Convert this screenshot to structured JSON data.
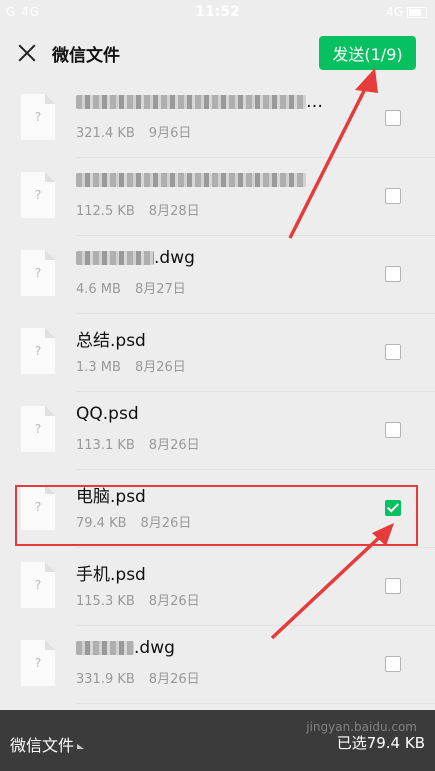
{
  "status": {
    "left": "G 4G",
    "time": "11:52",
    "right": "4G"
  },
  "header": {
    "title": "微信文件",
    "send_label": "发送(1/9)"
  },
  "files": [
    {
      "name": "…",
      "size": "321.4 KB",
      "date": "9月6日",
      "checked": false,
      "blur_w": 230
    },
    {
      "name": "",
      "size": "112.5 KB",
      "date": "8月28日",
      "checked": false,
      "blur_w": 230
    },
    {
      "name": ".dwg",
      "size": "4.6 MB",
      "date": "8月27日",
      "checked": false,
      "blur_w": 78
    },
    {
      "name": "总结.psd",
      "size": "1.3 MB",
      "date": "8月26日",
      "checked": false
    },
    {
      "name": "QQ.psd",
      "size": "113.1 KB",
      "date": "8月26日",
      "checked": false
    },
    {
      "name": "电脑.psd",
      "size": "79.4 KB",
      "date": "8月26日",
      "checked": true
    },
    {
      "name": "手机.psd",
      "size": "115.3 KB",
      "date": "8月26日",
      "checked": false
    },
    {
      "name": ".dwg",
      "size": "331.9 KB",
      "date": "8月26日",
      "checked": false,
      "blur_w": 58
    }
  ],
  "footer": {
    "folder_label": "微信文件",
    "selected_size": "已选79.4 KB"
  },
  "watermark": "jingyan.baidu.com",
  "colors": {
    "accent": "#07c160",
    "annotation": "#e63b3b",
    "footer_bg": "#3b3b3b"
  }
}
